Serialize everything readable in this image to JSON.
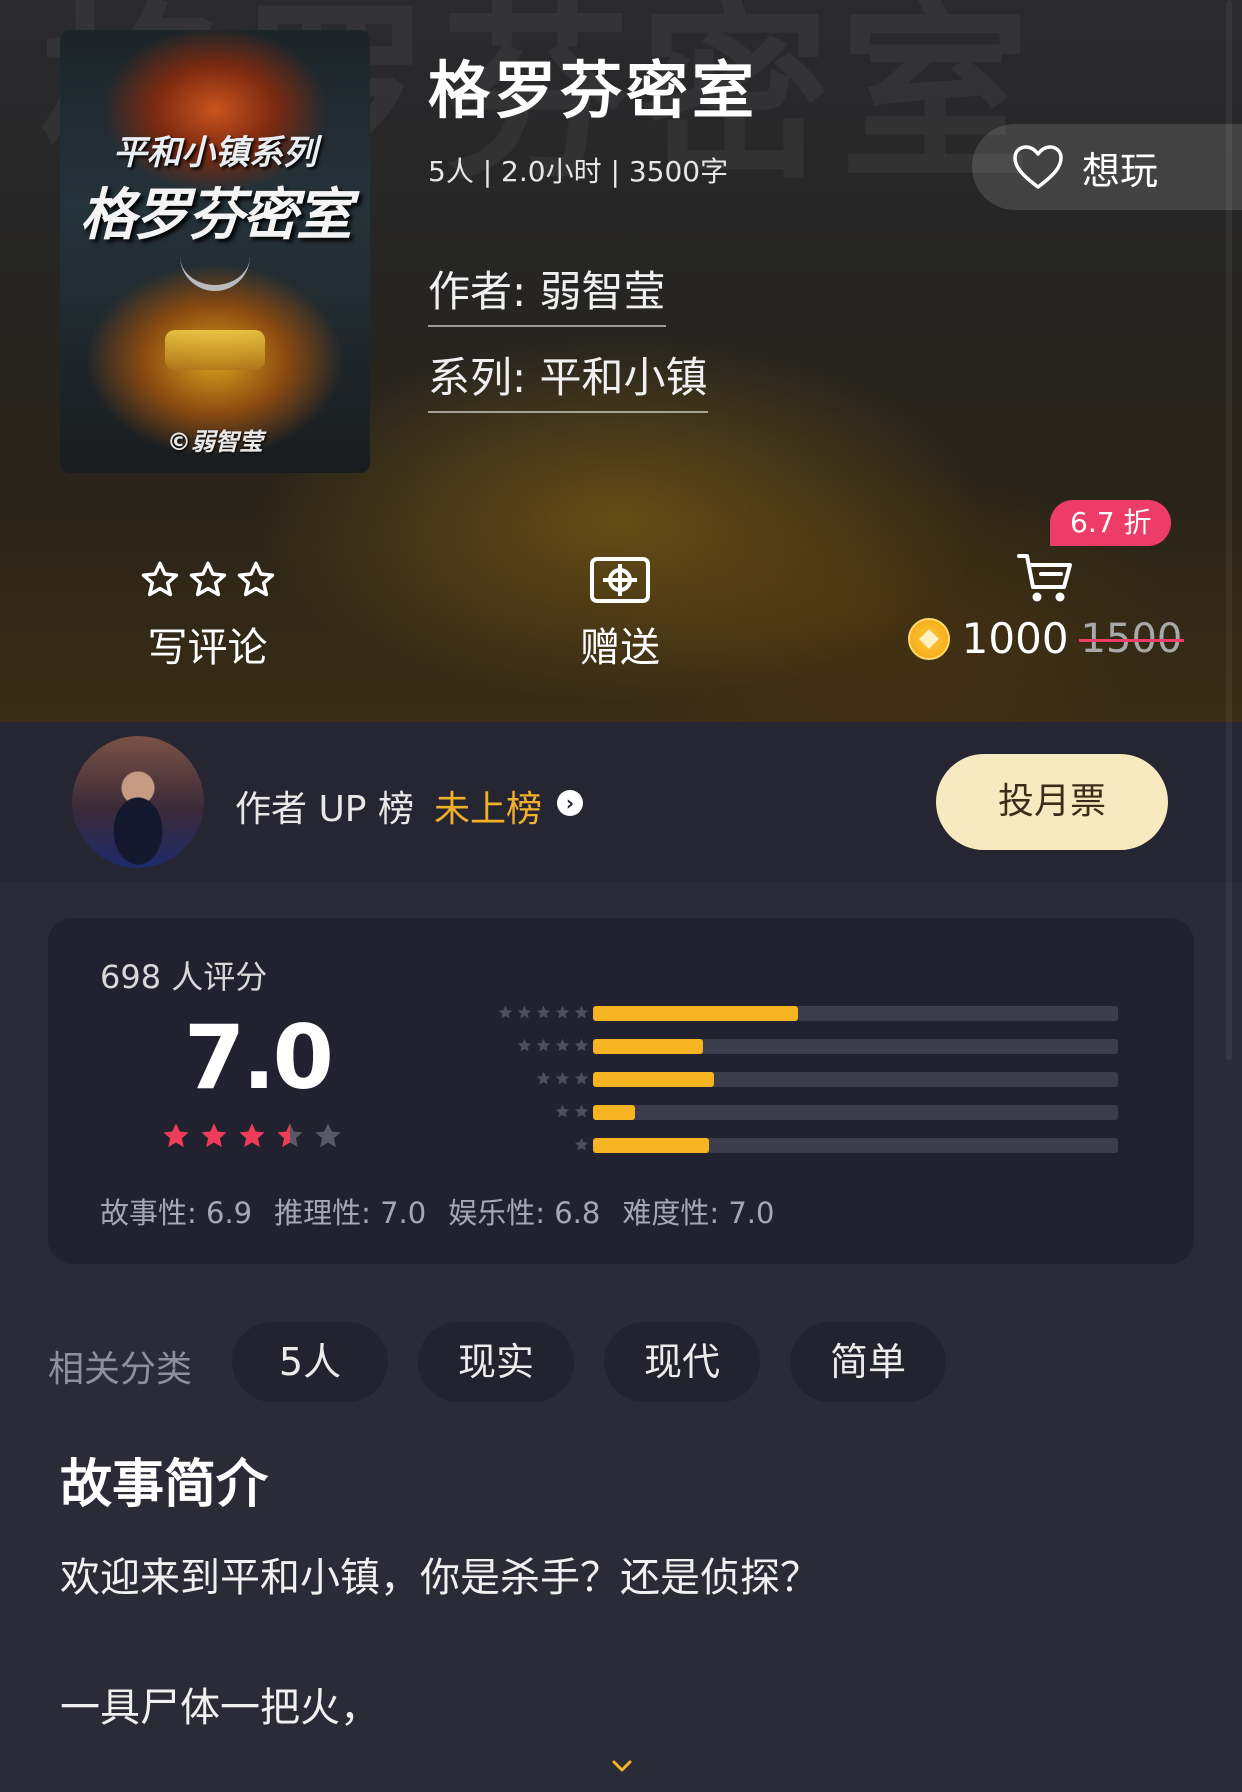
{
  "game": {
    "title": "格罗芬密室",
    "meta": "5人 | 2.0小时 | 3500字",
    "author": "作者: 弱智莹",
    "series": "系列: 平和小镇"
  },
  "cover": {
    "series_text": "平和小镇系列",
    "title_text": "格罗芬密室",
    "author_text": "©弱智莹"
  },
  "watermark": "格罗芬密室",
  "want_button": {
    "label": "想玩",
    "icon": "heart-icon"
  },
  "actions": {
    "review": {
      "label": "写评论",
      "icon": "star-outline-icon"
    },
    "gift": {
      "label": "赠送",
      "icon": "gift-ticket-icon"
    },
    "buy": {
      "icon": "cart-icon",
      "discount": "6.7 折",
      "price": "1000",
      "original_price": "1500"
    }
  },
  "author_rank": {
    "label": "作者 UP 榜",
    "status": "未上榜",
    "vote_button": "投月票"
  },
  "rating": {
    "count_label": "698 人评分",
    "score": "7.0",
    "stars": 3.5,
    "distribution": [
      {
        "stars": 5,
        "fraction": 0.39
      },
      {
        "stars": 4,
        "fraction": 0.21
      },
      {
        "stars": 3,
        "fraction": 0.23
      },
      {
        "stars": 2,
        "fraction": 0.08
      },
      {
        "stars": 1,
        "fraction": 0.22
      }
    ],
    "dimensions": [
      {
        "text": "故事性:  6.9"
      },
      {
        "text": "推理性:  7.0"
      },
      {
        "text": "娱乐性:  6.8"
      },
      {
        "text": "难度性:  7.0"
      }
    ]
  },
  "tags": {
    "label": "相关分类",
    "items": [
      "5人",
      "现实",
      "现代",
      "简单"
    ]
  },
  "story": {
    "title": "故事简介",
    "line1": "欢迎来到平和小镇，你是杀手？还是侦探？",
    "line2": "一具尸体一把火，"
  },
  "colors": {
    "accent_gold": "#f7b422",
    "discount_pink": "#ee3c68",
    "vote_button_bg": "#f8eac0",
    "star_red": "#ee3c5a"
  }
}
